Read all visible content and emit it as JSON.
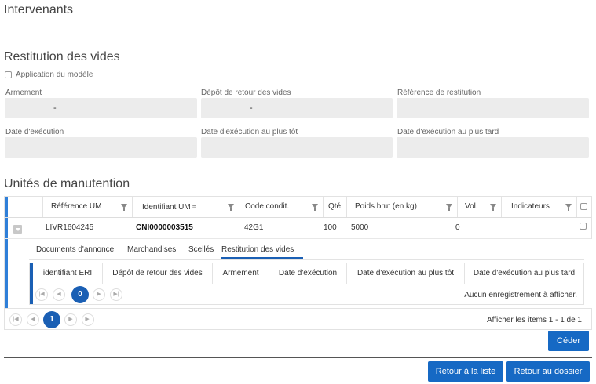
{
  "sections": {
    "intervenants": "Intervenants",
    "restitution": "Restitution des vides",
    "unites": "Unités de manutention"
  },
  "apply_model": {
    "label": "Application du modèle",
    "checked": false
  },
  "fields": {
    "armement": {
      "label": "Armement",
      "value": "-"
    },
    "depot": {
      "label": "Dépôt de retour des vides",
      "value": "-"
    },
    "reference": {
      "label": "Référence de restitution",
      "value": ""
    },
    "date_exec": {
      "label": "Date d'exécution",
      "value": ""
    },
    "date_tot": {
      "label": "Date d'exécution au plus tôt",
      "value": ""
    },
    "date_tard": {
      "label": "Date d'exécution au plus tard",
      "value": ""
    }
  },
  "grid": {
    "columns": [
      "Référence UM",
      "Identifiant UM",
      "Code condit.",
      "Qté",
      "Poids brut (en kg)",
      "Vol.",
      "Indicateurs"
    ],
    "row": {
      "reference": "LIVR1604245",
      "identifiant": "CNI0000003515",
      "code": "42G1",
      "qte": "100",
      "poids": "5000",
      "vol": "0",
      "indicateurs": ""
    },
    "tabs": [
      "Documents d'annonce",
      "Marchandises",
      "Scellés",
      "Restitution des vides"
    ],
    "active_tab": "Restitution des vides",
    "subgrid": {
      "columns": [
        "identifiant ERI",
        "Dépôt de retour des vides",
        "Armement",
        "Date d'exécution",
        "Date d'exécution au plus tôt",
        "Date d'exécution au plus tard"
      ],
      "page": "0",
      "empty_message": "Aucun enregistrement à afficher."
    },
    "page": "1",
    "items_info": "Afficher les items 1 - 1 de 1"
  },
  "buttons": {
    "ceder": "Céder",
    "retour_liste": "Retour à la liste",
    "retour_dossier": "Retour au dossier"
  },
  "colors": {
    "primary": "#1669c4",
    "accent": "#2f7fd8",
    "field_bg": "#ececec"
  }
}
